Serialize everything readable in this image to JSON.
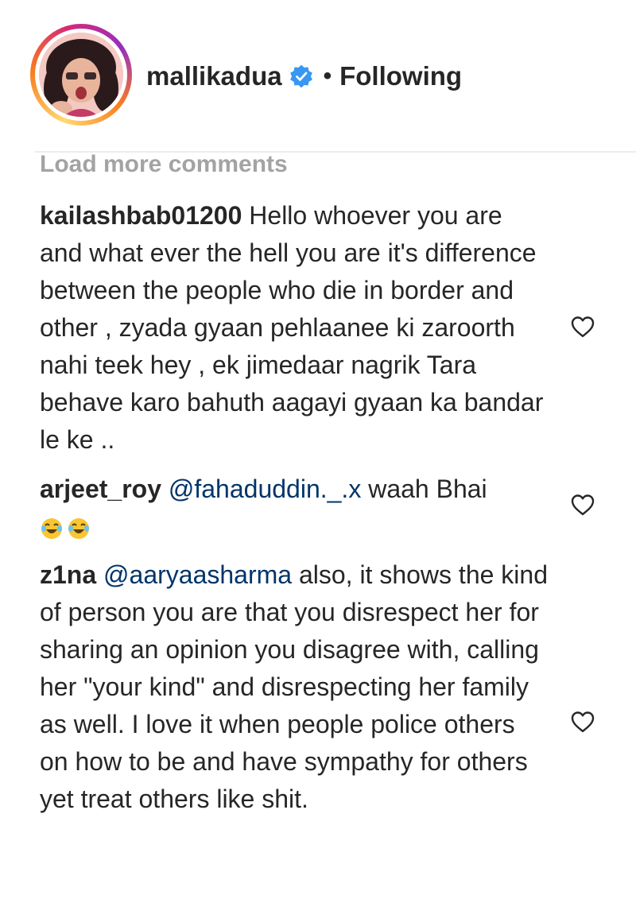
{
  "post_header": {
    "username": "mallikadua",
    "separator": "•",
    "follow_status": "Following",
    "verified": true
  },
  "load_more_label": "Load more comments",
  "comments": [
    {
      "username": "kailashbab01200",
      "text": "Hello whoever you are and what ever the hell you are it's difference between the people who die in border and other , zyada gyaan pehlaanee ki zaroorth nahi teek hey , ek jimedaar nagrik Tara behave karo bahuth aagayi gyaan ka bandar le ke .."
    },
    {
      "username": "arjeet_roy",
      "mention": "@fahaduddin._.x",
      "text": "waah Bhai",
      "emojis": [
        "laughing-emoji",
        "laughing-emoji"
      ]
    },
    {
      "username": "z1na",
      "mention": "@aaryaasharma",
      "text": "also, it shows the kind of person you are that you disrespect her for sharing an opinion you disagree with, calling her \"your kind\" and disrespecting her family as well. I love it when people police others on how to be and have sympathy for others yet treat others like shit."
    }
  ],
  "colors": {
    "text": "#262626",
    "mention": "#003569",
    "load_more": "#a3a3a3",
    "verified": "#3897f0"
  }
}
